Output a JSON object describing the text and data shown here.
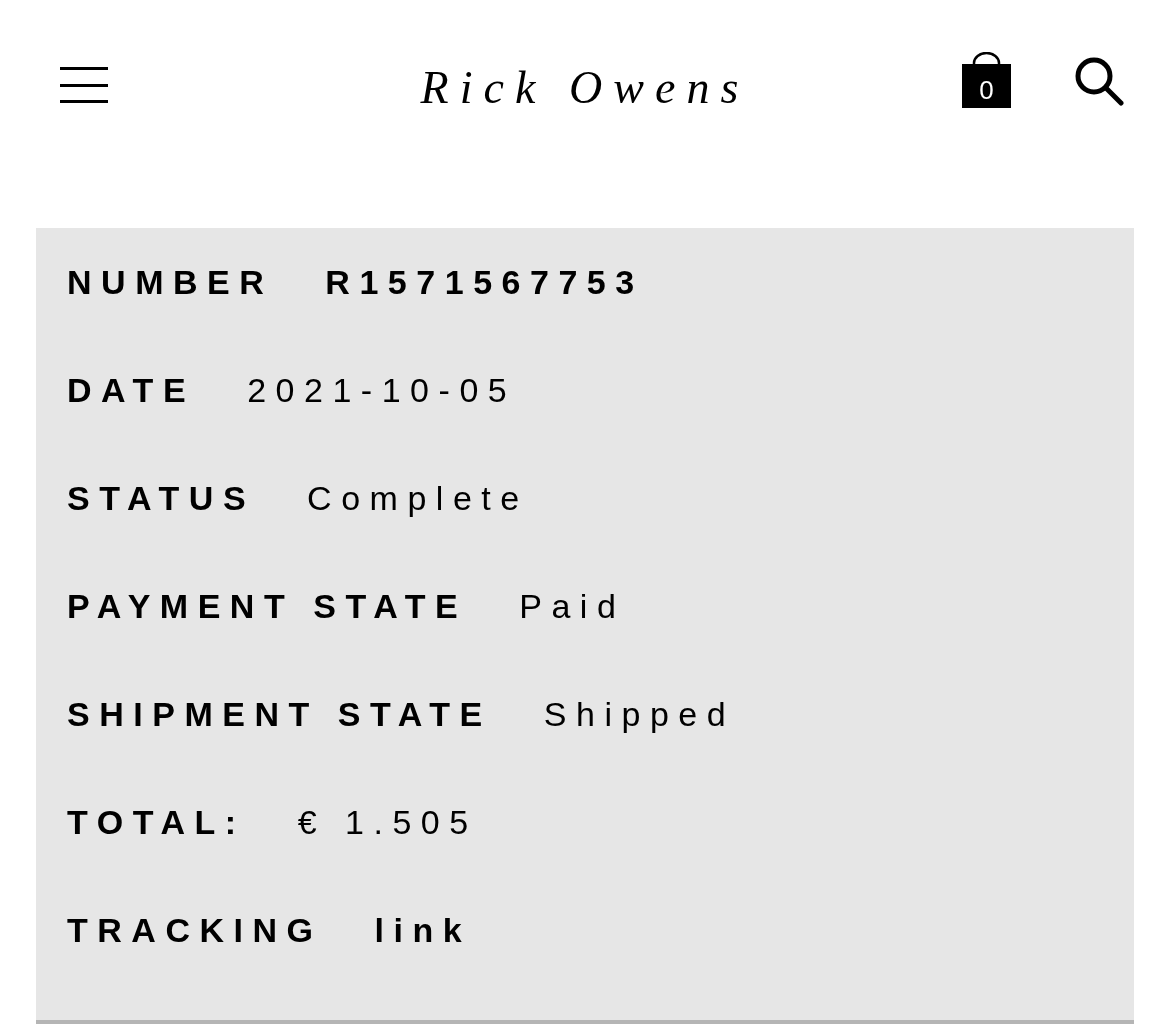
{
  "header": {
    "logo": "Rick Owens",
    "cart_count": "0"
  },
  "order_details": [
    {
      "label": "NUMBER",
      "value": "R1571567753",
      "kind": "bold"
    },
    {
      "label": "DATE",
      "value": "2021-10-05",
      "kind": "text"
    },
    {
      "label": "STATUS",
      "value": "Complete",
      "kind": "text"
    },
    {
      "label": "PAYMENT STATE",
      "value": "Paid",
      "kind": "text"
    },
    {
      "label": "SHIPMENT STATE",
      "value": "Shipped",
      "kind": "text"
    },
    {
      "label": "TOTAL:",
      "value": "€ 1.505",
      "kind": "text"
    },
    {
      "label": "TRACKING",
      "value": "link",
      "kind": "link"
    }
  ]
}
